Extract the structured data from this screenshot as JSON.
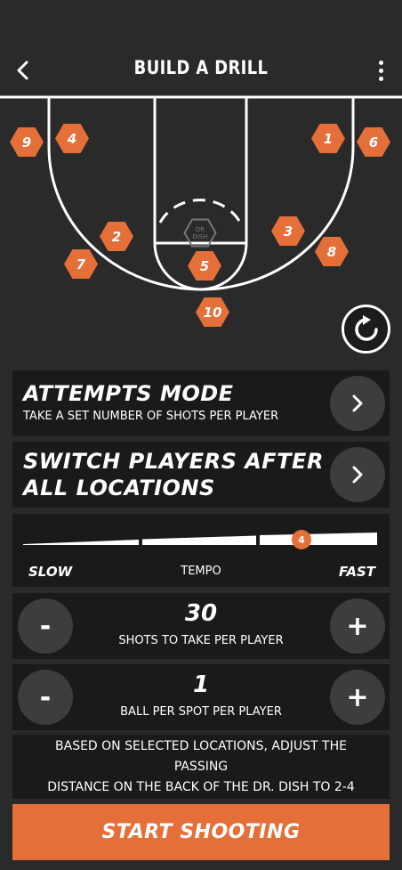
{
  "header": {
    "title": "BUILD A DRILL"
  },
  "court": {
    "dish_label_line1": "DR",
    "dish_label_line2": "DISH",
    "accent_color": "#e56f38",
    "spots": [
      "9",
      "4",
      "1",
      "6",
      "2",
      "3",
      "7",
      "8",
      "5",
      "10"
    ]
  },
  "mode": {
    "title": "ATTEMPTS MODE",
    "subtitle": "TAKE A SET NUMBER OF SHOTS PER PLAYER"
  },
  "switch": {
    "title_line1": "SWITCH PLAYERS AFTER",
    "title_line2": "ALL LOCATIONS"
  },
  "tempo": {
    "slow_label": "SLOW",
    "center_label": "TEMPO",
    "fast_label": "FAST",
    "value": "4"
  },
  "shots": {
    "value": "30",
    "label": "SHOTS TO TAKE PER PLAYER",
    "minus": "-",
    "plus": "+"
  },
  "balls": {
    "value": "1",
    "label": "BALL PER SPOT PER PLAYER",
    "minus": "-",
    "plus": "+"
  },
  "note": {
    "text_line1": "BASED ON SELECTED LOCATIONS, ADJUST THE PASSING",
    "text_line2": "DISTANCE ON THE BACK OF THE DR. DISH TO 2-4"
  },
  "start": {
    "label": "START SHOOTING"
  }
}
